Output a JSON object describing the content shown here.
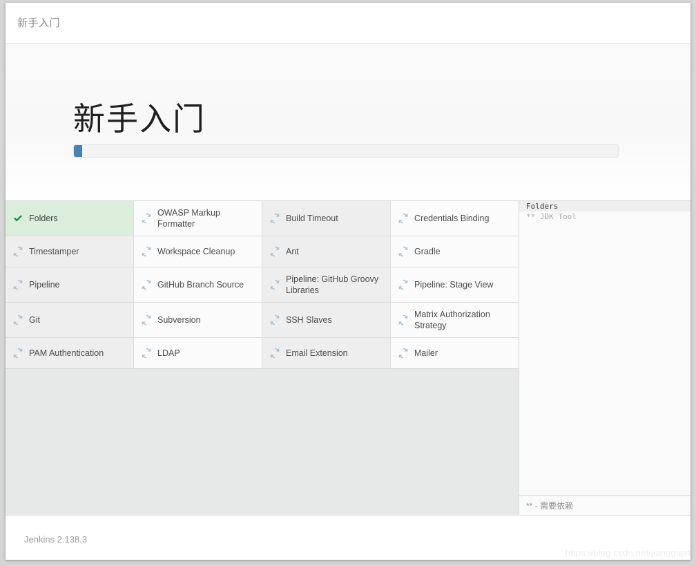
{
  "header": {
    "title": "新手入门"
  },
  "hero": {
    "title": "新手入门",
    "progress_percent": 1.5,
    "progress_fill_color": "#4a82b6",
    "progress_track_color": "#f3f3f3"
  },
  "plugins": {
    "status_icons": {
      "installed": "check-icon",
      "pending": "sync-icon"
    },
    "installed_color": "#1f8a33",
    "installed_bg": "#dbeedb",
    "pending_icon_color": "#a8c2d4",
    "items": [
      {
        "label": "Folders",
        "status": "installed"
      },
      {
        "label": "OWASP Markup Formatter",
        "status": "pending"
      },
      {
        "label": "Build Timeout",
        "status": "pending"
      },
      {
        "label": "Credentials Binding",
        "status": "pending"
      },
      {
        "label": "Timestamper",
        "status": "pending"
      },
      {
        "label": "Workspace Cleanup",
        "status": "pending"
      },
      {
        "label": "Ant",
        "status": "pending"
      },
      {
        "label": "Gradle",
        "status": "pending"
      },
      {
        "label": "Pipeline",
        "status": "pending"
      },
      {
        "label": "GitHub Branch Source",
        "status": "pending"
      },
      {
        "label": "Pipeline: GitHub Groovy Libraries",
        "status": "pending"
      },
      {
        "label": "Pipeline: Stage View",
        "status": "pending"
      },
      {
        "label": "Git",
        "status": "pending"
      },
      {
        "label": "Subversion",
        "status": "pending"
      },
      {
        "label": "SSH Slaves",
        "status": "pending"
      },
      {
        "label": "Matrix Authorization Strategy",
        "status": "pending"
      },
      {
        "label": "PAM Authentication",
        "status": "pending"
      },
      {
        "label": "LDAP",
        "status": "pending"
      },
      {
        "label": "Email Extension",
        "status": "pending"
      },
      {
        "label": "Mailer",
        "status": "pending"
      }
    ]
  },
  "log": {
    "lines": [
      {
        "text": "Folders",
        "current": true
      },
      {
        "text": "** JDK Tool",
        "current": false
      }
    ],
    "legend": "** - 需要依赖"
  },
  "footer": {
    "version": "Jenkins 2.138.3",
    "watermark": "https://blog.csdn.net/jianggujin"
  }
}
